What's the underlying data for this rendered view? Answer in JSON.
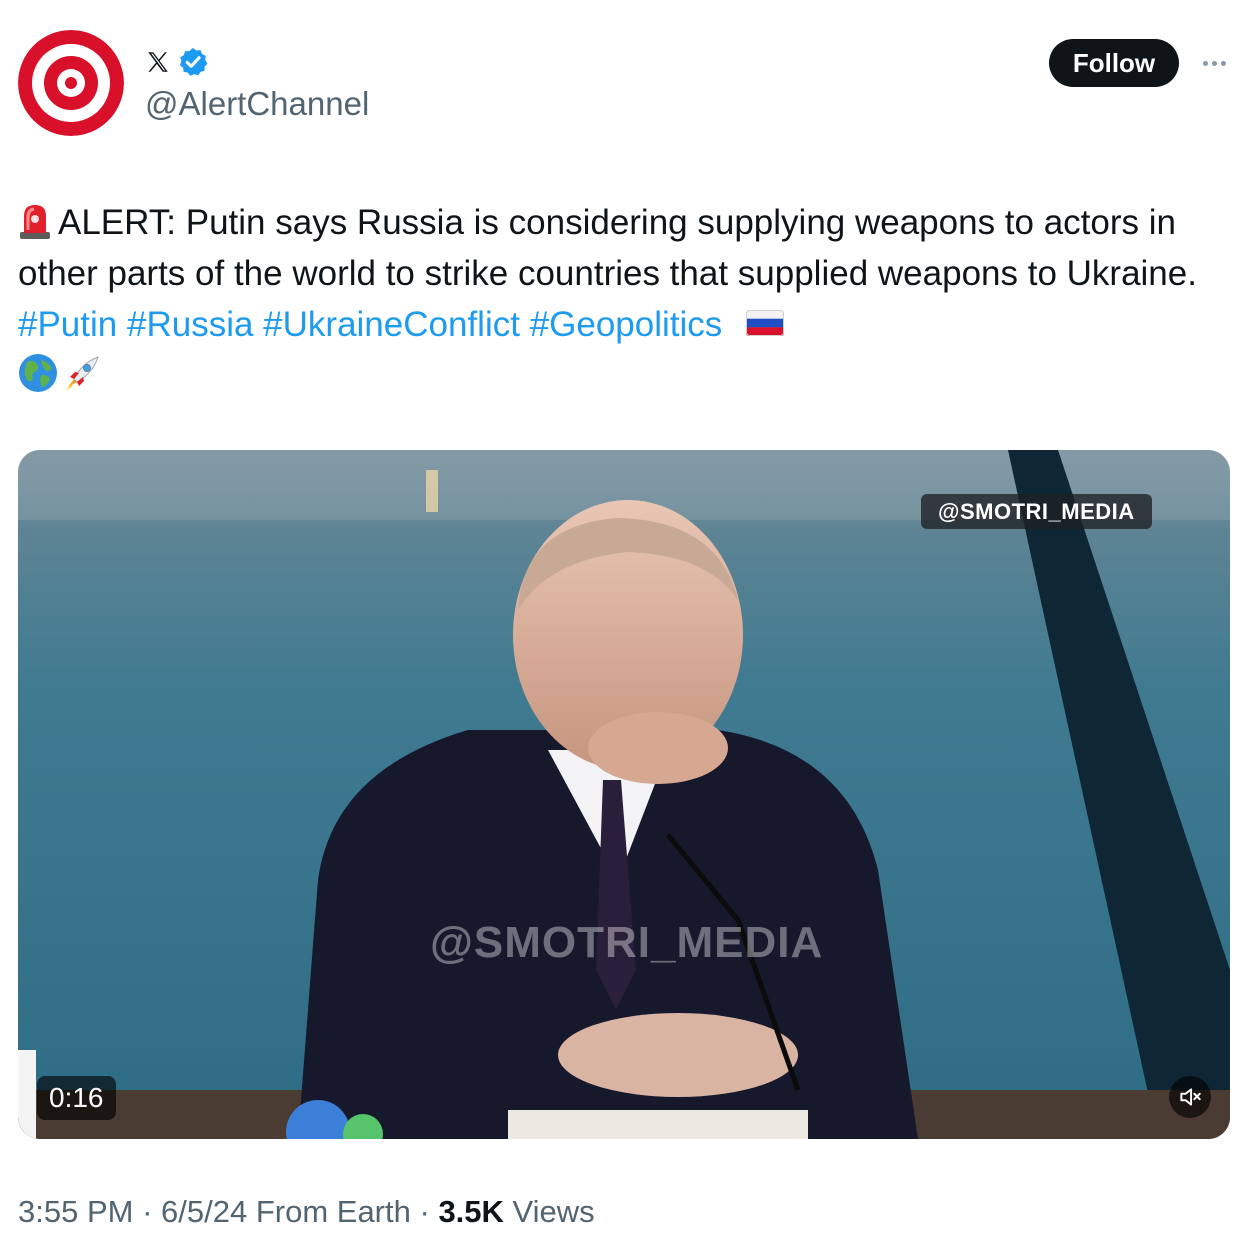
{
  "author": {
    "handle": "@AlertChannel",
    "avatar_icon": "red-target-logo",
    "platform_icon": "x-logo-icon",
    "verified_icon": "verified-badge-icon",
    "verified_color": "#1d9bf0"
  },
  "header": {
    "follow_label": "Follow",
    "more_icon": "more-options-icon"
  },
  "tweet": {
    "leading_emoji": "rotating-light-emoji",
    "text": "ALERT: Putin says Russia is considering supplying weapons to actors in other parts of the world to strike countries that supplied weapons to Ukraine.",
    "hashtags": [
      "#Putin",
      "#Russia",
      "#UkraineConflict",
      "#Geopolitics"
    ],
    "trailing_emojis": [
      "russia-flag-emoji",
      "globe-emoji",
      "rocket-emoji"
    ],
    "hashtag_color": "#1d9bf0"
  },
  "media": {
    "watermark_tag": "@SMOTRI_MEDIA",
    "watermark_center": "@SMOTRI_MEDIA",
    "duration": "0:16",
    "mute_icon": "speaker-muted-icon"
  },
  "meta": {
    "time": "3:55 PM",
    "sep1": " · ",
    "date": "6/5/24",
    "source": " From Earth",
    "sep2": " · ",
    "views_count": "3.5K",
    "views_label": " Views"
  }
}
